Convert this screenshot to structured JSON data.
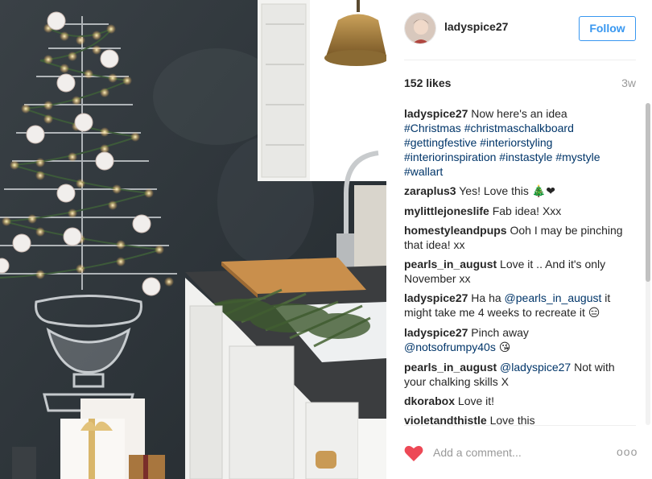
{
  "post": {
    "image_alt": "Chalkboard wall with a drawn Christmas tree and string lights in a kitchen",
    "username": "ladyspice27",
    "follow_label": "Follow",
    "likes": "152 likes",
    "time": "3w",
    "comment_placeholder": "Add a comment...",
    "more_label": "ooo"
  },
  "caption": {
    "user": "ladyspice27",
    "text": "Now here's an idea",
    "hashtags": [
      "#Christmas",
      "#christmaschalkboard",
      "#gettingfestive",
      "#interiorstyling",
      "#interiorinspiration",
      "#instastyle",
      "#mystyle",
      "#wallart"
    ]
  },
  "comments": [
    {
      "user": "zaraplus3",
      "text": "Yes! Love this ",
      "emoji": "🎄❤"
    },
    {
      "user": "mylittlejoneslife",
      "text": "Fab idea! Xxx"
    },
    {
      "user": "homestyleandpups",
      "text": "Ooh I may be pinching that idea! xx"
    },
    {
      "user": "pearls_in_august",
      "text": "Love it .. And it's only November xx"
    },
    {
      "user": "ladyspice27",
      "pre": "Ha ha ",
      "mention": "@pearls_in_august",
      "text": " it might take me 4 weeks to recreate it ",
      "emoji": "😑"
    },
    {
      "user": "ladyspice27",
      "text": "Pinch away ",
      "mention": "@notsofrumpy40s",
      "emoji": "😘"
    },
    {
      "user": "pearls_in_august",
      "mention": "@ladyspice27",
      "text": " Not with your chalking skills X"
    },
    {
      "user": "dkorabox",
      "text": "Love it!"
    },
    {
      "user": "violetandthistle",
      "text": "Love this"
    }
  ],
  "colors": {
    "accent": "#3897f0",
    "hashtag": "#003569",
    "heart": "#ed4956",
    "muted": "#999999"
  },
  "icons": {
    "heart": "heart-icon",
    "more": "more-options-icon"
  }
}
